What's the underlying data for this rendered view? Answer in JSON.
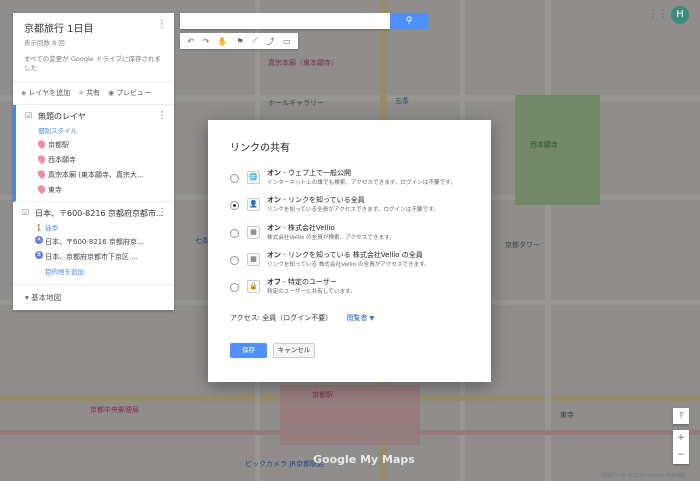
{
  "panel": {
    "title": "京都旅行 1日目",
    "views": "表示回数 8 回",
    "saved_note": "すべての変更が Google ドライブに保存されました",
    "add_layer": "レイヤを追加",
    "share": "共有",
    "preview": "プレビュー",
    "layer1": {
      "name": "無題のレイヤ",
      "style": "個別スタイル",
      "items": [
        "京都駅",
        "西本願寺",
        "真宗本廟 (東本願寺、真宗大...",
        "東寺"
      ]
    },
    "layer2": {
      "name": "日本、〒600-8216 京都府京都市...",
      "mode": "徒歩",
      "stops": [
        {
          "badge": "A",
          "label": "日本、〒600-8216 京都府京..."
        },
        {
          "badge": "B",
          "label": "日本、京都府京都市下京区 ..."
        }
      ],
      "add_dest": "目的地を追加"
    },
    "basemap": "基本地図"
  },
  "search": {
    "placeholder": ""
  },
  "avatar": {
    "initial": "H"
  },
  "dialog": {
    "title": "リンクの共有",
    "options": [
      {
        "icon": "globe-icon",
        "glyph": "🌐",
        "title": "オン",
        "title_rest": " - ウェブ上で一般公開",
        "desc": "インターネット上の誰でも検索、アクセスできます。ログインは不要です。",
        "selected": false
      },
      {
        "icon": "link-person-icon",
        "glyph": "👤",
        "title": "オン",
        "title_rest": " - リンクを知っている全員",
        "desc": "リンクを知っている全員がアクセスできます。ログインは不要です。",
        "selected": true
      },
      {
        "icon": "building-icon",
        "glyph": "▦",
        "title": "オン",
        "title_rest": " - 株式会社Vellio",
        "desc": "株式会社Vellio の全員が検索、アクセスできます。",
        "selected": false
      },
      {
        "icon": "building-link-icon",
        "glyph": "▦",
        "title": "オン",
        "title_rest": " - リンクを知っている 株式会社Vellio の全員",
        "desc": "リンクを知っている 株式会社Vellio の全員がアクセスできます。",
        "selected": false
      },
      {
        "icon": "lock-person-icon",
        "glyph": "🔒",
        "title": "オフ",
        "title_rest": " - 特定のユーザー",
        "desc": "特定のユーザーと共有しています。",
        "selected": false
      }
    ],
    "access_label": "アクセス: 全員（ログイン不要）",
    "role": "閲覧者",
    "save": "保存",
    "cancel": "キャンセル"
  },
  "map": {
    "labels": [
      "京都タワー",
      "真宗本廟（東本願寺）",
      "ホールギャラリー",
      "五条",
      "七条",
      "京都駅",
      "ビックカメラ JR京都駅店",
      "ヨドバシカメラ",
      "烏丸通",
      "梅小路公園",
      "西本願寺",
      "東寺",
      "京都中央郵便局"
    ],
    "logo": "Google My Maps",
    "copyright": "地図データ ©2019 Google   利用規約"
  }
}
